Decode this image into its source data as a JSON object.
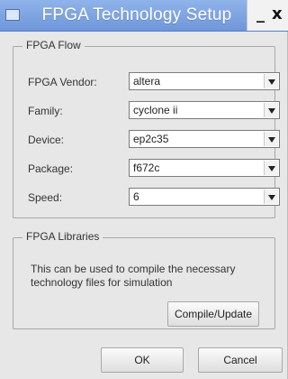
{
  "window": {
    "title": "FPGA Technology Setup",
    "minimize_label": "_",
    "close_label": "x"
  },
  "fpga_flow": {
    "group_title": "FPGA Flow",
    "rows": [
      {
        "label": "FPGA Vendor:",
        "value": "altera"
      },
      {
        "label": "Family:",
        "value": "cyclone ii"
      },
      {
        "label": "Device:",
        "value": "ep2c35"
      },
      {
        "label": "Package:",
        "value": "f672c"
      },
      {
        "label": "Speed:",
        "value": "6"
      }
    ]
  },
  "fpga_libraries": {
    "group_title": "FPGA Libraries",
    "description": "This can be used to compile the necessary technology files for simulation",
    "compile_button": "Compile/Update"
  },
  "footer": {
    "ok_button": "OK",
    "cancel_button": "Cancel"
  }
}
